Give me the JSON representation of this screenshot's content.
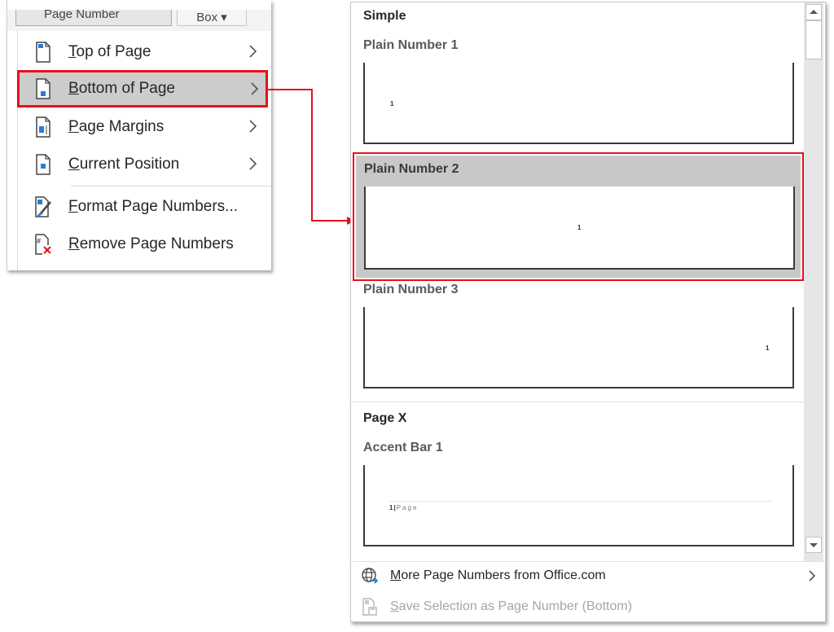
{
  "ribbon": {
    "page_number_button": "Page Number",
    "box_button": "Box ▾"
  },
  "menu": {
    "items": [
      {
        "label_prefix": "",
        "mnemonic": "T",
        "label_rest": "op of Page",
        "icon": "page-number-top-icon",
        "has_submenu": true
      },
      {
        "label_prefix": "",
        "mnemonic": "B",
        "label_rest": "ottom of Page",
        "icon": "page-number-bottom-icon",
        "has_submenu": true,
        "selected": true
      },
      {
        "label_prefix": "",
        "mnemonic": "P",
        "label_rest": "age Margins",
        "icon": "page-number-margins-icon",
        "has_submenu": true
      },
      {
        "label_prefix": "",
        "mnemonic": "C",
        "label_rest": "urrent Position",
        "icon": "page-number-current-icon",
        "has_submenu": true
      },
      {
        "label_prefix": "",
        "mnemonic": "F",
        "label_rest": "ormat Page Numbers...",
        "icon": "format-page-numbers-icon",
        "has_submenu": false
      },
      {
        "label_prefix": "",
        "mnemonic": "R",
        "label_rest": "emove Page Numbers",
        "icon": "remove-page-numbers-icon",
        "has_submenu": false
      }
    ]
  },
  "gallery": {
    "sections": [
      {
        "header": "Simple",
        "items": [
          {
            "title": "Plain Number 1",
            "preview_text": "1",
            "align": "left"
          },
          {
            "title": "Plain Number 2",
            "preview_text": "1",
            "align": "center",
            "selected": true
          },
          {
            "title": "Plain Number 3",
            "preview_text": "1",
            "align": "right"
          }
        ]
      },
      {
        "header": "Page X",
        "items": [
          {
            "title": "Accent Bar 1",
            "preview_number": "1",
            "preview_sep": "|",
            "preview_word": "Page"
          }
        ]
      }
    ],
    "footer": [
      {
        "mnemonic": "M",
        "label_rest": "ore Page Numbers from Office.com",
        "icon": "globe-arrow-icon",
        "has_submenu": true,
        "disabled": false
      },
      {
        "mnemonic": "S",
        "label_rest": "ave Selection as Page Number (Bottom)",
        "icon": "save-selection-icon",
        "has_submenu": false,
        "disabled": true
      }
    ]
  },
  "colors": {
    "highlight_red": "#e8101b",
    "selected_bg": "#cccccc",
    "icon_blue": "#2b7cd3"
  }
}
